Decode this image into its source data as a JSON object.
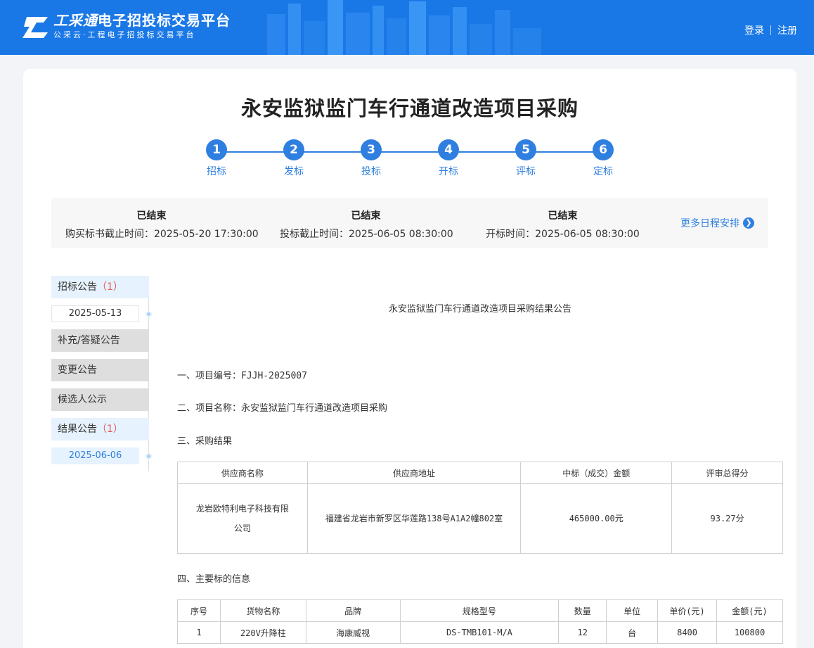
{
  "header": {
    "brand": "工采通",
    "title_rest": "电子招投标交易平台",
    "subtitle": "公采云·工程电子招投标交易平台",
    "login": "登录",
    "register": "注册"
  },
  "page_title": "永安监狱监门车行通道改造项目采购",
  "steps": [
    {
      "num": "1",
      "label": "招标"
    },
    {
      "num": "2",
      "label": "发标"
    },
    {
      "num": "3",
      "label": "投标"
    },
    {
      "num": "4",
      "label": "开标"
    },
    {
      "num": "5",
      "label": "评标"
    },
    {
      "num": "6",
      "label": "定标"
    }
  ],
  "schedule": [
    {
      "status": "已结束",
      "text": "购买标书截止时间：2025-05-20 17:30:00"
    },
    {
      "status": "已结束",
      "text": "投标截止时间：2025-06-05 08:30:00"
    },
    {
      "status": "已结束",
      "text": "开标时间：2025-06-05 08:30:00"
    }
  ],
  "more_schedule": "更多日程安排",
  "side_nav": {
    "tender_notice": "招标公告",
    "tender_count": "（1）",
    "tender_date": "2025-05-13",
    "supplement": "补充/答疑公告",
    "change": "变更公告",
    "candidate": "候选人公示",
    "result": "结果公告",
    "result_count": "（1）",
    "result_date": "2025-06-06"
  },
  "article": {
    "title": "永安监狱监门车行通道改造项目采购结果公告",
    "s1": "一、项目编号：FJJH-2025007",
    "s2": "二、项目名称：永安监狱监门车行通道改造项目采购",
    "s3": "三、采购结果",
    "s4": "四、主要标的信息",
    "result_table": {
      "headers": [
        "供应商名称",
        "供应商地址",
        "中标（成交）金额",
        "评审总得分"
      ],
      "row": [
        "龙岩欧特利电子科技有限公司",
        "福建省龙岩市新罗区华莲路138号A1A2幢802室",
        "465000.00元",
        "93.27分"
      ]
    },
    "goods_table": {
      "headers": [
        "序号",
        "货物名称",
        "品牌",
        "规格型号",
        "数量",
        "单位",
        "单价(元)",
        "金额(元)"
      ],
      "row": [
        "1",
        "220V升降柱",
        "海康威视",
        "DS-TMB101-M/A",
        "12",
        "台",
        "8400",
        "100800"
      ]
    }
  },
  "colors": {
    "primary": "#2f7fe0",
    "header_bg": "#1a78e6",
    "count_red": "#e35b5b"
  }
}
